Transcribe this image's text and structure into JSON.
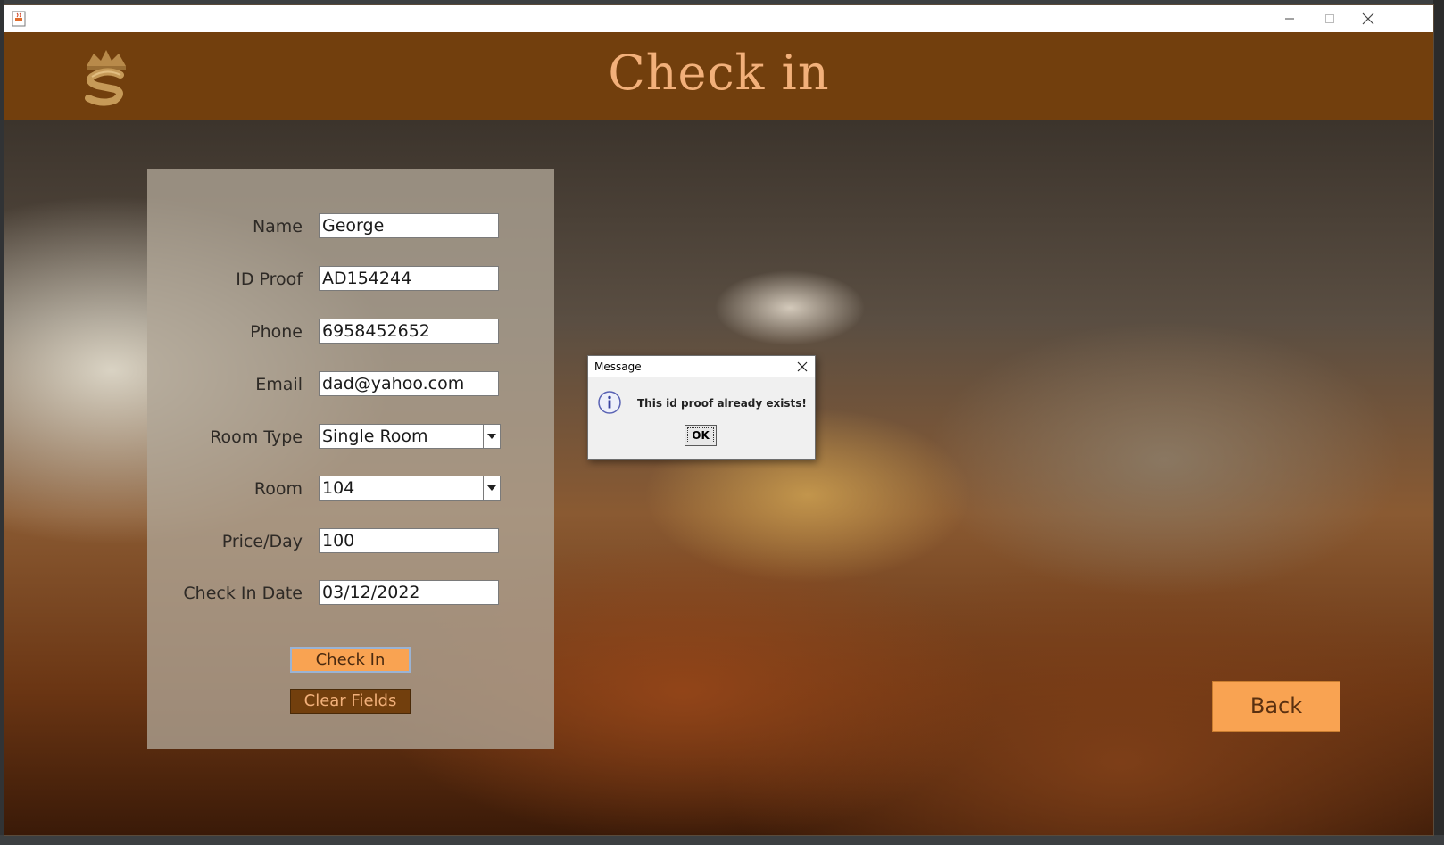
{
  "window": {
    "title": "",
    "minimize_label": "Minimize",
    "maximize_label": "Maximize",
    "close_label": "Close"
  },
  "header": {
    "title": "Check in",
    "logo_icon": "crown-s-logo-icon"
  },
  "form": {
    "fields": [
      {
        "label": "Name",
        "value": "George"
      },
      {
        "label": "ID Proof",
        "value": "AD154244"
      },
      {
        "label": "Phone",
        "value": "6958452652"
      },
      {
        "label": "Email",
        "value": "dad@yahoo.com"
      },
      {
        "label": "Room Type",
        "value": "Single Room"
      },
      {
        "label": "Room",
        "value": "104"
      },
      {
        "label": "Price/Day",
        "value": "100"
      },
      {
        "label": "Check In Date",
        "value": "03/12/2022"
      }
    ],
    "checkin_button": "Check In",
    "clear_button": "Clear Fields"
  },
  "back_button": "Back",
  "dialog": {
    "title": "Message",
    "message": "This id proof already exists!",
    "ok_button": "OK",
    "icon": "info-icon"
  },
  "colors": {
    "header": "#723f0d",
    "title_text": "#f2b07a",
    "accent_button": "#f9a352",
    "dark_button": "#723f0d"
  }
}
